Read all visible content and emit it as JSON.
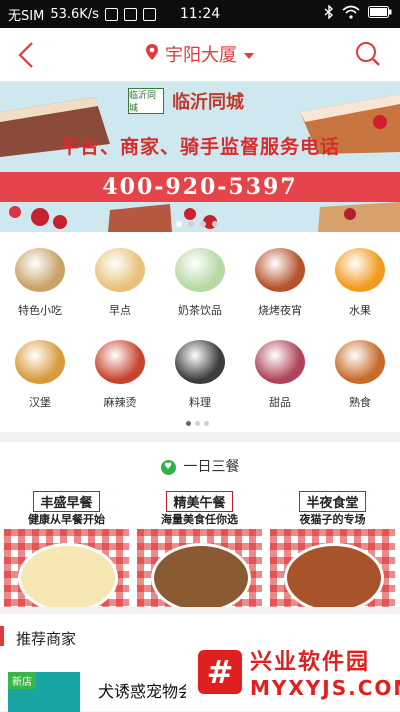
{
  "status": {
    "carrier": "无SIM",
    "speed": "53.6K/s",
    "time": "11:24"
  },
  "nav": {
    "location": "宇阳大厦"
  },
  "banner": {
    "brand": "临沂同城",
    "logo_text": "临沂同城",
    "slogan": "平台、商家、骑手监督服务电话",
    "phone": "400-920-5397"
  },
  "categories": [
    {
      "label": "特色小吃",
      "color": "#c8a267"
    },
    {
      "label": "早点",
      "color": "#e8c27a"
    },
    {
      "label": "奶茶饮品",
      "color": "#b7d9a3"
    },
    {
      "label": "烧烤夜宵",
      "color": "#b5532d"
    },
    {
      "label": "水果",
      "color": "#f29a1e"
    },
    {
      "label": "汉堡",
      "color": "#d99a3c"
    },
    {
      "label": "麻辣烫",
      "color": "#c7452e"
    },
    {
      "label": "料理",
      "color": "#3d3d3d"
    },
    {
      "label": "甜品",
      "color": "#b0445a"
    },
    {
      "label": "熟食",
      "color": "#c86b2a"
    }
  ],
  "meals": {
    "title": "一日三餐",
    "items": [
      {
        "title": "丰盛早餐",
        "subtitle": "健康从早餐开始"
      },
      {
        "title": "精美午餐",
        "subtitle": "海量美食任你选"
      },
      {
        "title": "半夜食堂",
        "subtitle": "夜猫子的专场"
      }
    ]
  },
  "recommend": {
    "title": "推荐商家",
    "badge": "新店",
    "shop_name": "犬诱惑宠物会所"
  },
  "watermark": {
    "title": "兴业软件园",
    "url": "MYXYJS.COM",
    "logo": "#"
  }
}
